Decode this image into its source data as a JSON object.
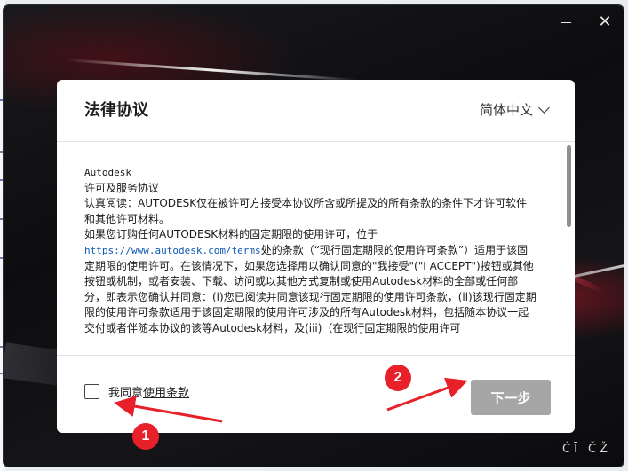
{
  "dialog": {
    "title": "法律协议",
    "language": "简体中文"
  },
  "license": {
    "lines": [
      "Autodesk",
      "许可及服务协议",
      "认真阅读：AUTODESK仅在被许可方接受本协议所含或所提及的所有条款的条件下才许可软件和其他许可材料。",
      "如果您订购任何AUTODESK材料的固定期限的使用许可，位于"
    ],
    "link": "https://www.autodesk.com/terms",
    "after_link": "处的条款（“现行固定期限的使用许可条款”）适用于该固定期限的使用许可。在该情况下，如果您选择用以确认同意的\"我接受\"(\"I ACCEPT\")按钮或其他按钮或机制，或者安装、下载、访问或以其他方式复制或使用Autodesk材料的全部或任何部分，即表示您确认并同意：(i)您已阅读并同意该现行固定期限的使用许可条款，(ii)该现行固定期限的使用许可条款适用于该固定期限的使用许可涉及的所有Autodesk材料，包括随本协议一起交付或者伴随本协议的该等Autodesk材料，及(iii)（在现行固定期限的使用许可"
  },
  "agree": {
    "prefix": "我同意",
    "link": "使用条款"
  },
  "next_button": "下一步",
  "annotations": [
    "1",
    "2"
  ],
  "window_buttons": {
    "minimize": "—",
    "close": "✕"
  },
  "bottom_icons": "ĆĪ ČŽ",
  "colors": {
    "annotation": "#e8202a",
    "button_disabled": "#a6a6a6",
    "link": "#0d59b7"
  }
}
